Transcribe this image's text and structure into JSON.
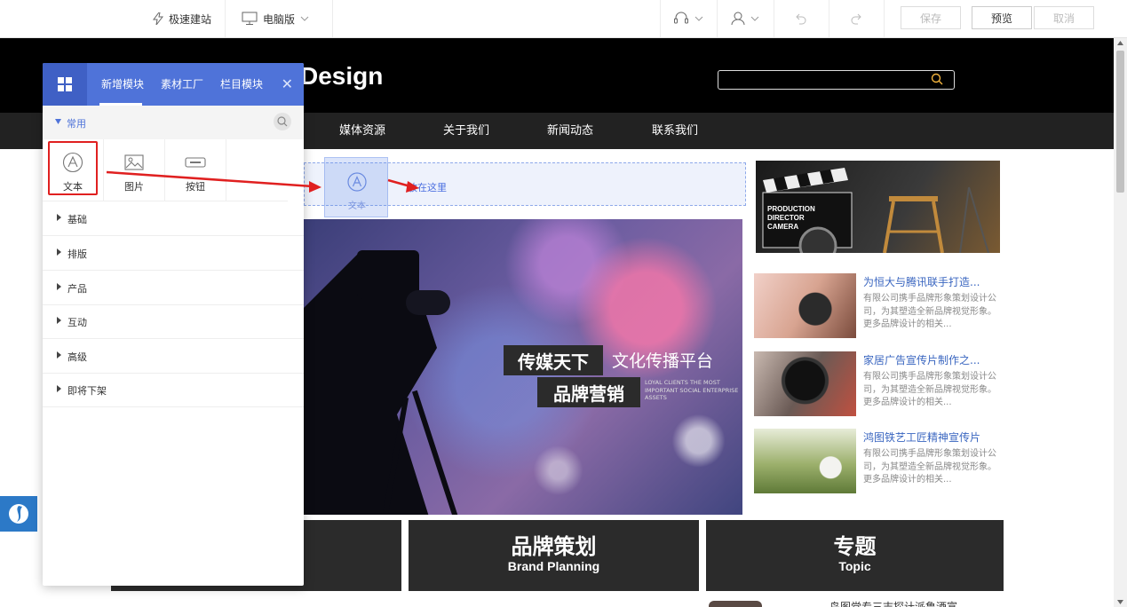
{
  "toolbar": {
    "quick_build": "极速建站",
    "device": "电脑版",
    "save": "保存",
    "preview": "预览",
    "cancel": "取消"
  },
  "site": {
    "logo": "Design",
    "nav": [
      "媒体资源",
      "关于我们",
      "新闻动态",
      "联系我们"
    ],
    "drop_hint": "放在这里",
    "drag_ghost_label": "文本",
    "banner": {
      "tag1": "传媒天下",
      "slogan": "文化传播平台",
      "tag2": "品牌营销",
      "en_text": "LOYAL CLIENTS THE MOST IMPORTANT SOCIAL ENTERPRISE ASSETS"
    },
    "featured_lines": [
      "PRODUCTION",
      "DIRECTOR",
      "CAMERA"
    ],
    "news": [
      {
        "title": "为恒大与腾讯联手打造...",
        "desc": "有限公司携手品牌形象策划设计公司，为其塑造全新品牌视觉形象。更多品牌设计的相关..."
      },
      {
        "title": "家居广告宣传片制作之...",
        "desc": "有限公司携手品牌形象策划设计公司，为其塑造全新品牌视觉形象。更多品牌设计的相关..."
      },
      {
        "title": "鸿图铁艺工匠精神宣传片",
        "desc": "有限公司携手品牌形象策划设计公司，为其塑造全新品牌视觉形象。更多品牌设计的相关..."
      }
    ],
    "categories": [
      {
        "cn": "品牌策划",
        "en": "Brand Planning"
      },
      {
        "cn": "专题",
        "en": "Topic"
      }
    ],
    "cut_text": "鸟图党专三志探计派鲁酒富"
  },
  "panel": {
    "tabs": [
      "新增模块",
      "素材工厂",
      "栏目模块"
    ],
    "common_label": "常用",
    "modules": [
      "文本",
      "图片",
      "按钮"
    ],
    "categories": [
      "基础",
      "排版",
      "产品",
      "互动",
      "高级",
      "即将下架"
    ]
  },
  "colors": {
    "panel_blue": "#4f73d9",
    "highlight_red": "#e02020",
    "link_blue": "#3a66c0"
  }
}
